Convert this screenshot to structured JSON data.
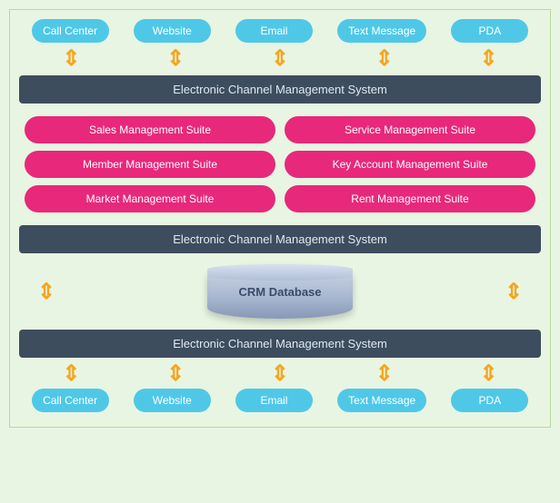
{
  "top_channels": [
    {
      "label": "Call Center",
      "id": "call-center-top"
    },
    {
      "label": "Website",
      "id": "website-top"
    },
    {
      "label": "Email",
      "id": "email-top"
    },
    {
      "label": "Text Message",
      "id": "text-message-top"
    },
    {
      "label": "PDA",
      "id": "pda-top"
    }
  ],
  "bottom_channels": [
    {
      "label": "Call Center",
      "id": "call-center-bottom"
    },
    {
      "label": "Website",
      "id": "website-bottom"
    },
    {
      "label": "Email",
      "id": "email-bottom"
    },
    {
      "label": "Text Message",
      "id": "text-message-bottom"
    },
    {
      "label": "PDA",
      "id": "pda-bottom"
    }
  ],
  "banner1": "Electronic Channel Management System",
  "banner2": "Electronic Channel Management System",
  "banner3": "Electronic Channel Management System",
  "suites_left": [
    "Sales Management Suite",
    "Member Management Suite",
    "Market Management Suite"
  ],
  "suites_right": [
    "Service Management Suite",
    "Key Account Management Suite",
    "Rent Management Suite"
  ],
  "crm_label": "CRM Database",
  "arrow_symbol": "⬆⬇"
}
